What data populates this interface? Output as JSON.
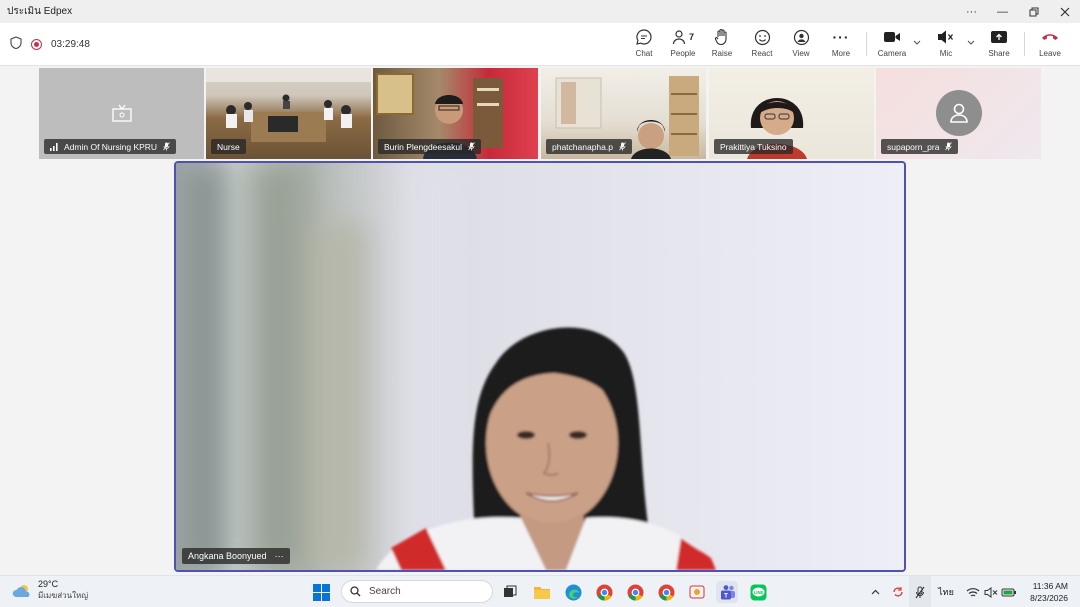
{
  "window": {
    "title": "ประเมิน Edpex"
  },
  "meeting": {
    "timer": "03:29:48",
    "toolbar": {
      "chat": "Chat",
      "people": "People",
      "people_count": "7",
      "raise": "Raise",
      "react": "React",
      "view": "View",
      "more": "More",
      "camera": "Camera",
      "mic": "Mic",
      "share": "Share",
      "leave": "Leave"
    },
    "participants": [
      {
        "name": "Admin Of Nursing KPRU"
      },
      {
        "name": "Nurse"
      },
      {
        "name": "Burin Plengdeesakul"
      },
      {
        "name": "phatchanapha.p"
      },
      {
        "name": "Prakittiya Tuksino"
      },
      {
        "name": "supaporn_pra"
      }
    ],
    "main_speaker": {
      "name": "Angkana Boonyued",
      "menu": "···"
    }
  },
  "taskbar": {
    "weather_temp": "29°C",
    "weather_desc": "มีเมฆส่วนใหญ่",
    "search_placeholder": "Search",
    "lang": "ไทย",
    "time": "11:36 AM",
    "date": "8/23/2026"
  },
  "colors": {
    "accent": "#4f52b2",
    "record": "#c4314b",
    "leave": "#c4314b"
  }
}
